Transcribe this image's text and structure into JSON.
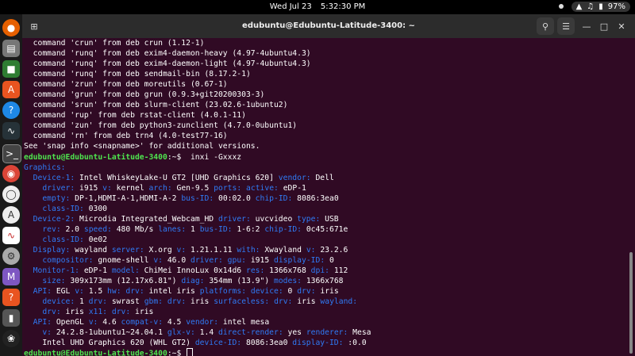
{
  "topbar": {
    "date": "Wed Jul 23",
    "time": "5:32:30 PM",
    "battery": "97%"
  },
  "window": {
    "title": "edubuntu@Edubuntu-Latitude-3400: ~"
  },
  "terminal": {
    "prompt_user": "edubuntu@Edubuntu-Latitude-3400",
    "prompt_suffix": ":~$",
    "command": "inxi -Gxxxz",
    "lines_plain": [
      "  command 'crun' from deb crun (1.12-1)",
      "  command 'runq' from deb exim4-daemon-heavy (4.97-4ubuntu4.3)",
      "  command 'runq' from deb exim4-daemon-light (4.97-4ubuntu4.3)",
      "  command 'runq' from deb sendmail-bin (8.17.2-1)",
      "  command 'zrun' from deb moreutils (0.67-1)",
      "  command 'grun' from deb grun (0.9.3+git20200303-3)",
      "  command 'srun' from deb slurm-client (23.02.6-1ubuntu2)",
      "  command 'rup' from deb rstat-client (4.0.1-11)",
      "  command 'zun' from deb python3-zunclient (4.7.0-0ubuntu1)",
      "  command 'rn' from deb trn4 (4.0-test77-16)",
      "See 'snap info <snapname>' for additional versions."
    ],
    "info": [
      [
        [
          "k",
          "Graphics:"
        ]
      ],
      [
        [
          "t",
          "  "
        ],
        [
          "k",
          "Device-1:"
        ],
        [
          "t",
          " Intel WhiskeyLake-U GT2 [UHD Graphics 620] "
        ],
        [
          "k",
          "vendor:"
        ],
        [
          "t",
          " Dell"
        ]
      ],
      [
        [
          "t",
          "    "
        ],
        [
          "k",
          "driver:"
        ],
        [
          "t",
          " i915 "
        ],
        [
          "k",
          "v:"
        ],
        [
          "t",
          " kernel "
        ],
        [
          "k",
          "arch:"
        ],
        [
          "t",
          " Gen-9.5 "
        ],
        [
          "k",
          "ports:"
        ],
        [
          "t",
          " "
        ],
        [
          "k",
          "active:"
        ],
        [
          "t",
          " eDP-1"
        ]
      ],
      [
        [
          "t",
          "    "
        ],
        [
          "k",
          "empty:"
        ],
        [
          "t",
          " DP-1,HDMI-A-1,HDMI-A-2 "
        ],
        [
          "k",
          "bus-ID:"
        ],
        [
          "t",
          " 00:02.0 "
        ],
        [
          "k",
          "chip-ID:"
        ],
        [
          "t",
          " 8086:3ea0"
        ]
      ],
      [
        [
          "t",
          "    "
        ],
        [
          "k",
          "class-ID:"
        ],
        [
          "t",
          " 0300"
        ]
      ],
      [
        [
          "t",
          "  "
        ],
        [
          "k",
          "Device-2:"
        ],
        [
          "t",
          " Microdia Integrated_Webcam_HD "
        ],
        [
          "k",
          "driver:"
        ],
        [
          "t",
          " uvcvideo "
        ],
        [
          "k",
          "type:"
        ],
        [
          "t",
          " USB"
        ]
      ],
      [
        [
          "t",
          "    "
        ],
        [
          "k",
          "rev:"
        ],
        [
          "t",
          " 2.0 "
        ],
        [
          "k",
          "speed:"
        ],
        [
          "t",
          " 480 Mb/s "
        ],
        [
          "k",
          "lanes:"
        ],
        [
          "t",
          " 1 "
        ],
        [
          "k",
          "bus-ID:"
        ],
        [
          "t",
          " 1-6:2 "
        ],
        [
          "k",
          "chip-ID:"
        ],
        [
          "t",
          " 0c45:671e"
        ]
      ],
      [
        [
          "t",
          "    "
        ],
        [
          "k",
          "class-ID:"
        ],
        [
          "t",
          " 0e02"
        ]
      ],
      [
        [
          "t",
          "  "
        ],
        [
          "k",
          "Display:"
        ],
        [
          "t",
          " wayland "
        ],
        [
          "k",
          "server:"
        ],
        [
          "t",
          " X.org "
        ],
        [
          "k",
          "v:"
        ],
        [
          "t",
          " 1.21.1.11 "
        ],
        [
          "k",
          "with:"
        ],
        [
          "t",
          " Xwayland "
        ],
        [
          "k",
          "v:"
        ],
        [
          "t",
          " 23.2.6"
        ]
      ],
      [
        [
          "t",
          "    "
        ],
        [
          "k",
          "compositor:"
        ],
        [
          "t",
          " gnome-shell "
        ],
        [
          "k",
          "v:"
        ],
        [
          "t",
          " 46.0 "
        ],
        [
          "k",
          "driver:"
        ],
        [
          "t",
          " "
        ],
        [
          "k",
          "gpu:"
        ],
        [
          "t",
          " i915 "
        ],
        [
          "k",
          "display-ID:"
        ],
        [
          "t",
          " 0"
        ]
      ],
      [
        [
          "t",
          "  "
        ],
        [
          "k",
          "Monitor-1:"
        ],
        [
          "t",
          " eDP-1 "
        ],
        [
          "k",
          "model:"
        ],
        [
          "t",
          " ChiMei InnoLux 0x14d6 "
        ],
        [
          "k",
          "res:"
        ],
        [
          "t",
          " 1366x768 "
        ],
        [
          "k",
          "dpi:"
        ],
        [
          "t",
          " 112"
        ]
      ],
      [
        [
          "t",
          "    "
        ],
        [
          "k",
          "size:"
        ],
        [
          "t",
          " 309x173mm (12.17x6.81\") "
        ],
        [
          "k",
          "diag:"
        ],
        [
          "t",
          " 354mm (13.9\") "
        ],
        [
          "k",
          "modes:"
        ],
        [
          "t",
          " 1366x768"
        ]
      ],
      [
        [
          "t",
          "  "
        ],
        [
          "k",
          "API:"
        ],
        [
          "t",
          " EGL "
        ],
        [
          "k",
          "v:"
        ],
        [
          "t",
          " 1.5 "
        ],
        [
          "k",
          "hw:"
        ],
        [
          "t",
          " "
        ],
        [
          "k",
          "drv:"
        ],
        [
          "t",
          " intel iris "
        ],
        [
          "k",
          "platforms:"
        ],
        [
          "t",
          " "
        ],
        [
          "k",
          "device:"
        ],
        [
          "t",
          " 0 "
        ],
        [
          "k",
          "drv:"
        ],
        [
          "t",
          " iris"
        ]
      ],
      [
        [
          "t",
          "    "
        ],
        [
          "k",
          "device:"
        ],
        [
          "t",
          " 1 "
        ],
        [
          "k",
          "drv:"
        ],
        [
          "t",
          " swrast "
        ],
        [
          "k",
          "gbm:"
        ],
        [
          "t",
          " "
        ],
        [
          "k",
          "drv:"
        ],
        [
          "t",
          " iris "
        ],
        [
          "k",
          "surfaceless:"
        ],
        [
          "t",
          " "
        ],
        [
          "k",
          "drv:"
        ],
        [
          "t",
          " iris "
        ],
        [
          "k",
          "wayland:"
        ]
      ],
      [
        [
          "t",
          "    "
        ],
        [
          "k",
          "drv:"
        ],
        [
          "t",
          " iris "
        ],
        [
          "k",
          "x11:"
        ],
        [
          "t",
          " "
        ],
        [
          "k",
          "drv:"
        ],
        [
          "t",
          " iris"
        ]
      ],
      [
        [
          "t",
          "  "
        ],
        [
          "k",
          "API:"
        ],
        [
          "t",
          " OpenGL "
        ],
        [
          "k",
          "v:"
        ],
        [
          "t",
          " 4.6 "
        ],
        [
          "k",
          "compat-v:"
        ],
        [
          "t",
          " 4.5 "
        ],
        [
          "k",
          "vendor:"
        ],
        [
          "t",
          " intel mesa"
        ]
      ],
      [
        [
          "t",
          "    "
        ],
        [
          "k",
          "v:"
        ],
        [
          "t",
          " 24.2.8-1ubuntu1~24.04.1 "
        ],
        [
          "k",
          "glx-v:"
        ],
        [
          "t",
          " 1.4 "
        ],
        [
          "k",
          "direct-render:"
        ],
        [
          "t",
          " yes "
        ],
        [
          "k",
          "renderer:"
        ],
        [
          "t",
          " Mesa"
        ]
      ],
      [
        [
          "t",
          "    Intel UHD Graphics 620 (WHL GT2) "
        ],
        [
          "k",
          "device-ID:"
        ],
        [
          "t",
          " 8086:3ea0 "
        ],
        [
          "k",
          "display-ID:"
        ],
        [
          "t",
          " :0.0"
        ]
      ]
    ]
  },
  "dock": {
    "icons": [
      "firefox-icon",
      "files-icon",
      "libreoffice-icon",
      "app-center-icon",
      "help-icon",
      "system-monitor-icon",
      "terminal-icon",
      "chromium-icon",
      "messaging-icon",
      "accessibility-icon",
      "charts-icon",
      "settings-icon",
      "math-icon",
      "help-question-icon",
      "usb-icon",
      "ubuntu-icon"
    ]
  },
  "colors": {
    "terminal_bg": "#300a24",
    "prompt_green": "#4ee44e",
    "key_blue": "#2f7bf6"
  }
}
